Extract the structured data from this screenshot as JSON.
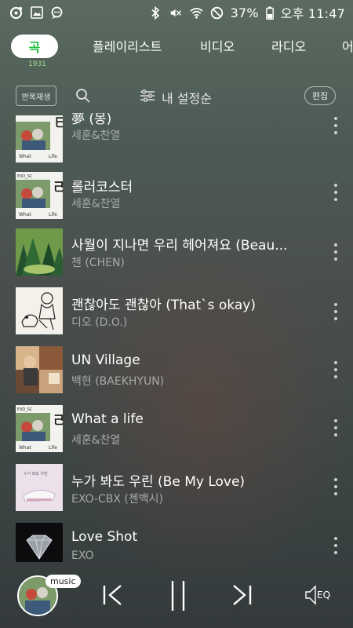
{
  "status_bar": {
    "battery": "37%",
    "time": "오후 11:47",
    "icons_left": [
      "sync-icon",
      "gallery-icon",
      "notification-icon"
    ],
    "icons_right": [
      "bluetooth-icon",
      "mute-icon",
      "wifi-icon",
      "do-not-disturb-icon"
    ]
  },
  "tabs": {
    "logo_label": "곡",
    "logo_sub": "1931",
    "items": [
      "플레이리스트",
      "비디오",
      "라디오",
      "어"
    ]
  },
  "toolbar": {
    "repeat_label": "반복재생",
    "sort_label": "내 설정순",
    "edit_label": "편집"
  },
  "songs": [
    {
      "title": "夢 (몽)",
      "artist": "세훈&찬열",
      "art": "sehun"
    },
    {
      "title": "롤러코스터",
      "artist": "세훈&찬열",
      "art": "sehun"
    },
    {
      "title": "사월이 지나면 우리 헤어져요 (Beau...",
      "artist": "첸 (CHEN)",
      "art": "chen"
    },
    {
      "title": "괜찮아도 괜찮아 (That`s okay)",
      "artist": "디오 (D.O.)",
      "art": "do"
    },
    {
      "title": "UN Village",
      "artist": "백현 (BAEKHYUN)",
      "art": "baek"
    },
    {
      "title": "What a life",
      "artist": "세훈&찬열",
      "art": "sehun"
    },
    {
      "title": "누가 봐도 우린 (Be My Love)",
      "artist": "EXO-CBX (첸백시)",
      "art": "cbx"
    },
    {
      "title": "Love Shot",
      "artist": "EXO",
      "art": "exo"
    }
  ],
  "player": {
    "badge": "music",
    "eq_label": "EQ"
  },
  "colors": {
    "accent": "#1fbf3f",
    "subtext": "#a6aaa8"
  }
}
